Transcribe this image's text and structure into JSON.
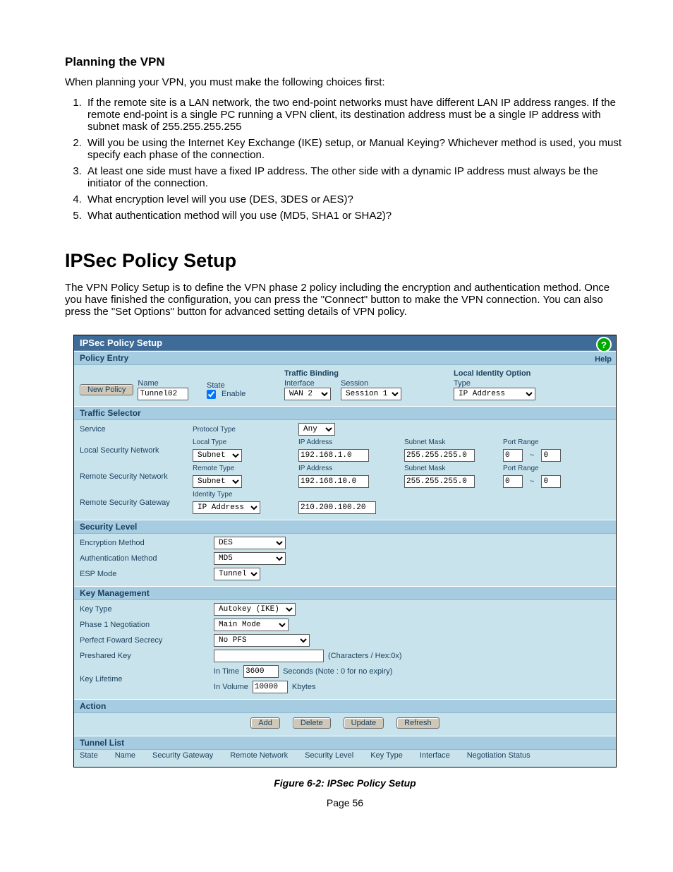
{
  "doc": {
    "planning_heading": "Planning the VPN",
    "planning_intro": "When planning your VPN, you must make the following choices first:",
    "planning_items": [
      "If the remote site is a LAN network, the two end-point networks must have different LAN IP address ranges. If the remote end-point is a single PC running a VPN client, its destination address must be a single IP address with subnet mask of 255.255.255.255",
      "Will you be using the Internet Key Exchange (IKE) setup, or Manual Keying? Whichever method is used, you must specify each phase of the connection.",
      "At least one side must have a fixed IP address. The other side with a dynamic IP address must always be the initiator of the connection.",
      "What encryption level will you use (DES, 3DES or AES)?",
      "What authentication method will you use (MD5, SHA1 or SHA2)?"
    ],
    "ipsec_heading": "IPSec Policy Setup",
    "ipsec_desc": "The VPN Policy Setup is to define the VPN phase 2 policy including the encryption and authentication method. Once you have finished the configuration, you can press the \"Connect\" button to make the VPN connection. You can also press the \"Set Options\" button for advanced setting details of VPN policy.",
    "figure_caption": "Figure 6-2: IPSec Policy Setup",
    "page_number": "Page 56"
  },
  "panel": {
    "title": "IPSec Policy Setup",
    "help": "Help",
    "policy_entry": {
      "heading": "Policy Entry",
      "new_policy_btn": "New Policy",
      "name_lbl": "Name",
      "name_val": "Tunnel02",
      "state_lbl": "State",
      "enable_lbl": "Enable",
      "traffic_binding_lbl": "Traffic Binding",
      "interface_lbl": "Interface",
      "interface_val": "WAN 2",
      "session_lbl": "Session",
      "session_val": "Session 1",
      "local_identity_lbl": "Local Identity Option",
      "type_lbl": "Type",
      "type_val": "IP Address"
    },
    "traffic_selector": {
      "heading": "Traffic Selector",
      "service_lbl": "Service",
      "protocol_type_lbl": "Protocol Type",
      "protocol_type_val": "Any",
      "local_net_lbl": "Local Security Network",
      "local_type_lbl": "Local Type",
      "local_type_val": "Subnet",
      "local_ip_lbl": "IP Address",
      "local_ip_val": "192.168.1.0",
      "local_mask_lbl": "Subnet Mask",
      "local_mask_val": "255.255.255.0",
      "local_port_lbl": "Port Range",
      "local_port_a": "0",
      "local_port_b": "0",
      "remote_net_lbl": "Remote Security Network",
      "remote_type_lbl": "Remote Type",
      "remote_type_val": "Subnet",
      "remote_ip_lbl": "IP Address",
      "remote_ip_val": "192.168.10.0",
      "remote_mask_lbl": "Subnet Mask",
      "remote_mask_val": "255.255.255.0",
      "remote_port_lbl": "Port Range",
      "remote_port_a": "0",
      "remote_port_b": "0",
      "remote_gw_lbl": "Remote Security Gateway",
      "identity_type_lbl": "Identity Type",
      "identity_type_val": "IP Address",
      "gw_ip_val": "210.200.100.20"
    },
    "security_level": {
      "heading": "Security Level",
      "encryption_lbl": "Encryption Method",
      "encryption_val": "DES",
      "auth_lbl": "Authentication Method",
      "auth_val": "MD5",
      "esp_lbl": "ESP Mode",
      "esp_val": "Tunnel"
    },
    "key_mgmt": {
      "heading": "Key Management",
      "key_type_lbl": "Key Type",
      "key_type_val": "Autokey (IKE)",
      "phase1_lbl": "Phase 1 Negotiation",
      "phase1_val": "Main Mode",
      "pfs_lbl": "Perfect Foward Secrecy",
      "pfs_val": "No PFS",
      "psk_lbl": "Preshared Key",
      "psk_note": "(Characters / Hex:0x)",
      "lifetime_lbl": "Key Lifetime",
      "in_time_lbl": "In Time",
      "in_time_val": "3600",
      "in_time_unit": "Seconds (Note : 0 for no expiry)",
      "in_vol_lbl": "In Volume",
      "in_vol_val": "10000",
      "in_vol_unit": "Kbytes"
    },
    "action": {
      "heading": "Action",
      "add": "Add",
      "delete": "Delete",
      "update": "Update",
      "refresh": "Refresh"
    },
    "tunnel_list": {
      "heading": "Tunnel List",
      "cols": [
        "State",
        "Name",
        "Security Gateway",
        "Remote Network",
        "Security Level",
        "Key Type",
        "Interface",
        "Negotiation Status"
      ]
    }
  }
}
